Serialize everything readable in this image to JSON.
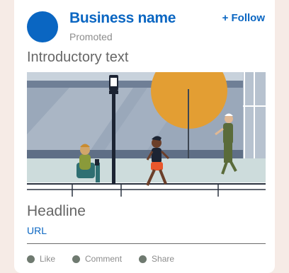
{
  "post": {
    "business_name": "Business name",
    "promoted_label": "Promoted",
    "follow_label": "+ Follow",
    "intro_text": "Introductory text",
    "headline": "Headline",
    "url": "URL"
  },
  "actions": {
    "like": "Like",
    "comment": "Comment",
    "share": "Share"
  },
  "colors": {
    "brand": "#0a66c2",
    "background": "#f6ebe6",
    "sun": "#e39e33"
  }
}
